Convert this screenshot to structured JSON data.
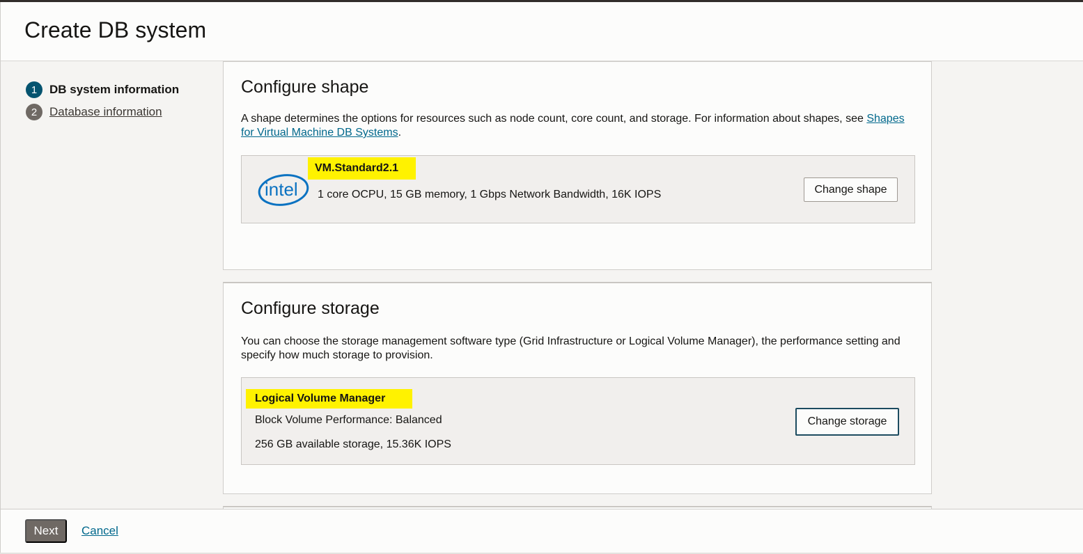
{
  "page": {
    "title": "Create DB system"
  },
  "steps": [
    {
      "number": "1",
      "label": "DB system information"
    },
    {
      "number": "2",
      "label": "Database information"
    }
  ],
  "shape": {
    "title": "Configure shape",
    "desc_text": "A shape determines the options for resources such as node count, core count, and storage. For information about shapes, see",
    "desc_link": "Shapes for Virtual Machine DB Systems",
    "desc_end": ".",
    "vendor_logo_text": "intel",
    "name": "VM.Standard2.1",
    "details": "1 core OCPU, 15 GB memory, 1 Gbps Network Bandwidth, 16K IOPS",
    "change_label": "Change shape"
  },
  "storage": {
    "title": "Configure storage",
    "desc": "You can choose the storage management software type (Grid Infrastructure or Logical Volume Manager), the performance setting and specify how much storage to provision.",
    "name": "Logical Volume Manager",
    "performance": "Block Volume Performance: Balanced",
    "capacity": "256 GB available storage, 15.36K IOPS",
    "change_label": "Change storage"
  },
  "footer": {
    "next_label": "Next",
    "cancel_label": "Cancel"
  },
  "colors": {
    "highlight": "#fff200",
    "active_step": "#04536f",
    "link": "#00688c",
    "next_button": "#6f6964"
  }
}
